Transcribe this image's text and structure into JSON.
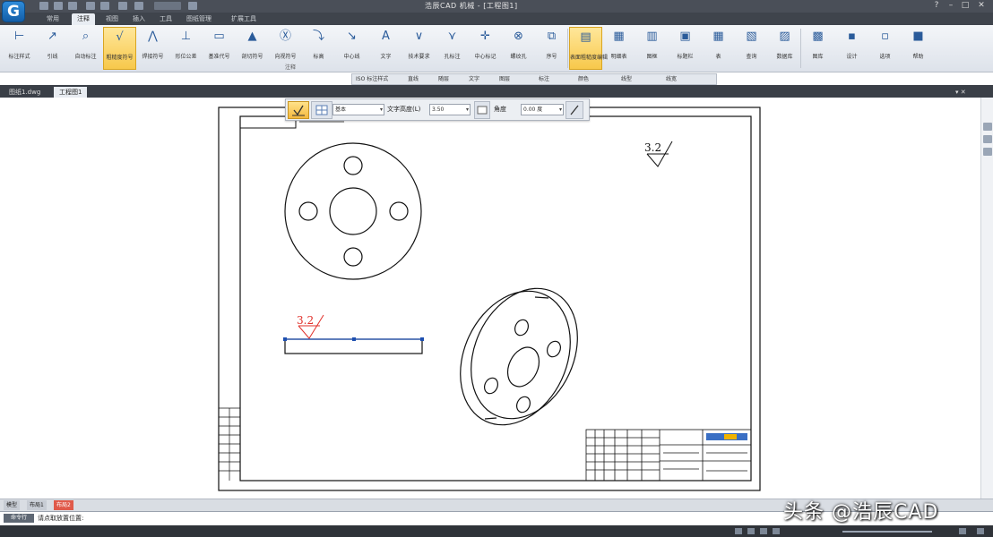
{
  "app": {
    "logo_letter": "G",
    "title": "浩辰CAD 机械 - [工程图1]",
    "tabs": [
      "常用",
      "注释",
      "视图",
      "插入",
      "工具",
      "图纸管理",
      "扩展工具"
    ],
    "active_tab": 1
  },
  "ribbon": {
    "tools": [
      {
        "label": "标注样式",
        "icon": "dimension-style-icon",
        "glyph": "⊢"
      },
      {
        "label": "引线",
        "icon": "leader-icon",
        "glyph": "↗"
      },
      {
        "label": "自动标注",
        "icon": "auto-dim-icon",
        "glyph": "⌕"
      },
      {
        "label": "粗糙度符号",
        "icon": "roughness-icon",
        "glyph": "√",
        "highlighted": true
      },
      {
        "label": "焊接符号",
        "icon": "weld-icon",
        "glyph": "⋀"
      },
      {
        "label": "形位公差",
        "icon": "tolerance-icon",
        "glyph": "⊥"
      },
      {
        "label": "基准代号",
        "icon": "datum-icon",
        "glyph": "▭"
      },
      {
        "label": "剖切符号",
        "icon": "section-icon",
        "glyph": "▲"
      },
      {
        "label": "向视符号",
        "icon": "view-arrow-icon",
        "glyph": "Ⓧ"
      },
      {
        "label": "标高",
        "icon": "elevation-icon",
        "glyph": "⤵"
      },
      {
        "label": "中心线",
        "icon": "centerline-icon",
        "glyph": "↘"
      },
      {
        "label": "文字",
        "icon": "text-icon",
        "glyph": "A"
      },
      {
        "label": "技术要求",
        "icon": "tech-req-icon",
        "glyph": "∨"
      },
      {
        "label": "孔标注",
        "icon": "hole-note-icon",
        "glyph": "⋎"
      },
      {
        "label": "中心标记",
        "icon": "center-mark-icon",
        "glyph": "✛"
      },
      {
        "label": "螺纹孔",
        "icon": "thread-icon",
        "glyph": "⊗"
      },
      {
        "label": "序号",
        "icon": "balloon-icon",
        "glyph": "⧉"
      },
      {
        "label": "表面粗糙度编辑",
        "icon": "roughness-edit-icon",
        "glyph": "▤",
        "highlighted": true
      },
      {
        "label": "明细表",
        "icon": "bom-icon",
        "glyph": "▦"
      },
      {
        "label": "图框",
        "icon": "frame-icon",
        "glyph": "▥"
      },
      {
        "label": "标题栏",
        "icon": "titleblock-icon",
        "glyph": "▣"
      },
      {
        "label": "表",
        "icon": "table-icon",
        "glyph": "▦"
      },
      {
        "label": "查询",
        "icon": "query-icon",
        "glyph": "▧"
      },
      {
        "label": "数据库",
        "icon": "database-icon",
        "glyph": "▨"
      },
      {
        "label": "图库",
        "icon": "library-icon",
        "glyph": "▩"
      },
      {
        "label": "设计",
        "icon": "design-icon",
        "glyph": "▪"
      },
      {
        "label": "选项",
        "icon": "options-icon",
        "glyph": "▫"
      },
      {
        "label": "帮助",
        "icon": "help-icon",
        "glyph": "■"
      }
    ],
    "group_label": "注释"
  },
  "property_toolbar": {
    "items": [
      "ISO 标注样式",
      "直线",
      "随层",
      "文字",
      "图层",
      "标注",
      "颜色",
      "线型",
      "线宽"
    ]
  },
  "doc_tabs": [
    "图纸1.dwg",
    "工程图1"
  ],
  "symbol_toolbar": {
    "style_value": "基本",
    "text_height_label": "文字高度(L)",
    "text_height_value": "3.50",
    "angle_label": "角度",
    "angle_value": "0.00",
    "angle_unit": "度"
  },
  "drawing": {
    "roughness_value_top": "3.2",
    "roughness_value_edit": "3.2"
  },
  "sheets": [
    "模型",
    "布局1",
    "布局2"
  ],
  "command": {
    "label": "命令行",
    "text": "请点取放置位置:"
  },
  "watermark": "头条 @浩辰CAD",
  "colors": {
    "title_bg": "#4a4f58",
    "ribbon_bg": "#e8ecf2",
    "highlight": "#f7c84b",
    "drawing_line": "#111111",
    "selected_symbol": "#e0302a",
    "selection_line": "#1d4fb0"
  }
}
